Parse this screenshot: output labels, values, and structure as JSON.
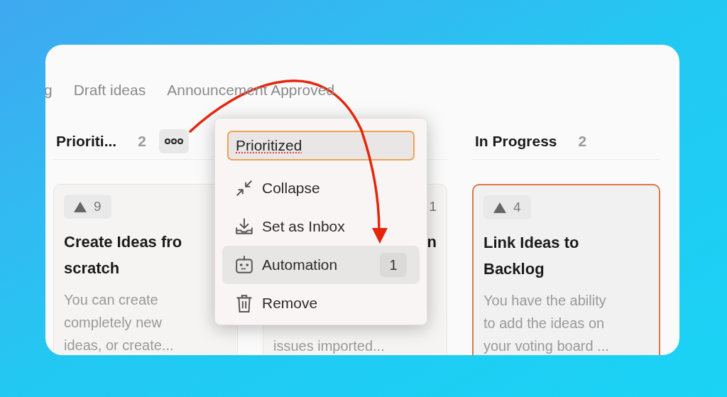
{
  "tabs": [
    {
      "label": "g"
    },
    {
      "label": "Draft ideas"
    },
    {
      "label": "Announcement Approved"
    }
  ],
  "columns": [
    {
      "title": "Prioriti...",
      "count": "2",
      "menu_button": true,
      "cards": [
        {
          "votes": "9",
          "title_lines": [
            "Create Ideas fro",
            "scratch"
          ],
          "description_lines": [
            "You can create",
            "completely new",
            "ideas, or create..."
          ],
          "highlighted": false
        }
      ]
    },
    {
      "cards": [
        {
          "votes": "1",
          "title_lines": [
            "n"
          ],
          "description_lines": [
            "issues imported..."
          ],
          "highlighted": false,
          "kind": "covered"
        }
      ]
    },
    {
      "title": "In Progress",
      "count": "2",
      "menu_button": false,
      "cards": [
        {
          "votes": "4",
          "title_lines": [
            "Link Ideas to",
            "Backlog"
          ],
          "description_lines": [
            "You have the ability",
            "to add the ideas on",
            "your voting board ..."
          ],
          "highlighted": true
        }
      ]
    }
  ],
  "menu": {
    "input_value": "Prioritized",
    "items": [
      {
        "kind": "collapse",
        "label": "Collapse",
        "selected": false
      },
      {
        "kind": "inbox",
        "label": "Set as Inbox",
        "selected": false
      },
      {
        "kind": "automation",
        "label": "Automation",
        "badge": "1",
        "selected": true
      },
      {
        "kind": "remove",
        "label": "Remove",
        "selected": false
      }
    ]
  }
}
